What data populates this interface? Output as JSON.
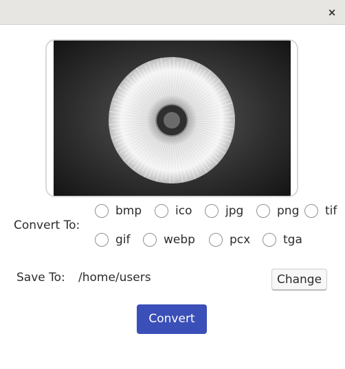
{
  "window": {
    "close_symbol": "×",
    "close_icon": "close-icon"
  },
  "preview": {
    "image_subject": "dandelion seed head, black and white photo"
  },
  "convert": {
    "label": "Convert To:",
    "formats": [
      "bmp",
      "ico",
      "jpg",
      "png",
      "tif",
      "gif",
      "webp",
      "pcx",
      "tga"
    ]
  },
  "save": {
    "label": "Save To:",
    "path": "/home/users",
    "change_label": "Change"
  },
  "actions": {
    "convert_label": "Convert"
  },
  "colors": {
    "accent": "#3b4fb8",
    "titlebar": "#e8e6e3"
  }
}
